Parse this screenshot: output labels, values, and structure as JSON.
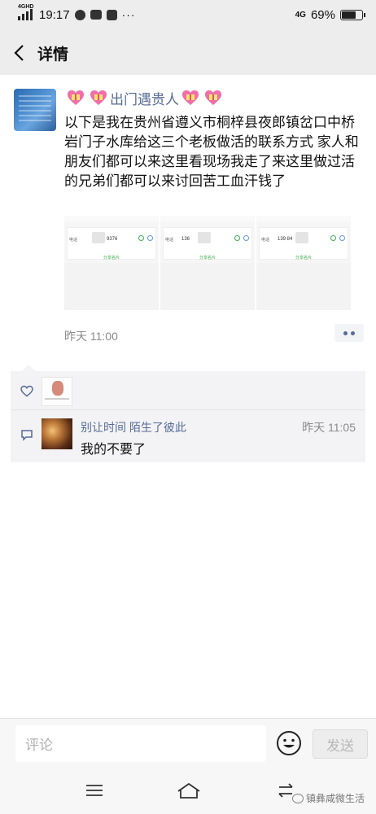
{
  "status_bar": {
    "network": "4GHD",
    "time": "19:17",
    "right_network": "4G",
    "battery_pct": "69%",
    "battery_level": 0.69
  },
  "nav": {
    "back_icon": "chevron-left-icon",
    "title": "详情"
  },
  "post": {
    "author_name": "出门遇贵人",
    "author_icons": [
      "heart-gift-icon",
      "heart-gift-icon"
    ],
    "content": "以下是我在贵州省遵义市桐梓县夜郎镇岔口中桥岩门子水库给这三个老板做活的联系方式 家人和朋友们都可以来这里看现场我走了来这里做过活的兄弟们都可以来讨回苦工血汗钱了",
    "images": [
      {
        "tel_label": "电话",
        "number": "9376",
        "share": "分享名片"
      },
      {
        "tel_label": "电话",
        "number": "136",
        "share": "分享名片"
      },
      {
        "tel_label": "电话",
        "number": "139 84",
        "share": "分享名片"
      }
    ],
    "time": "昨天 11:00",
    "more_icon": "more-dots-icon"
  },
  "interactions": {
    "like_icon": "heart-outline-icon",
    "comment_icon": "comment-icon",
    "comments": [
      {
        "name": "别让时间 陌生了彼此",
        "time": "昨天 11:05",
        "text": "我的不要了"
      }
    ]
  },
  "comment_bar": {
    "placeholder": "评论",
    "emoji_icon": "emoji-icon",
    "send_label": "发送"
  },
  "system_nav": {
    "menu_icon": "menu-icon",
    "home_icon": "home-icon",
    "back_icon": "switch-icon"
  },
  "watermark": "镇彝咸微生活",
  "colors": {
    "link": "#576b95",
    "background": "#ededed"
  }
}
